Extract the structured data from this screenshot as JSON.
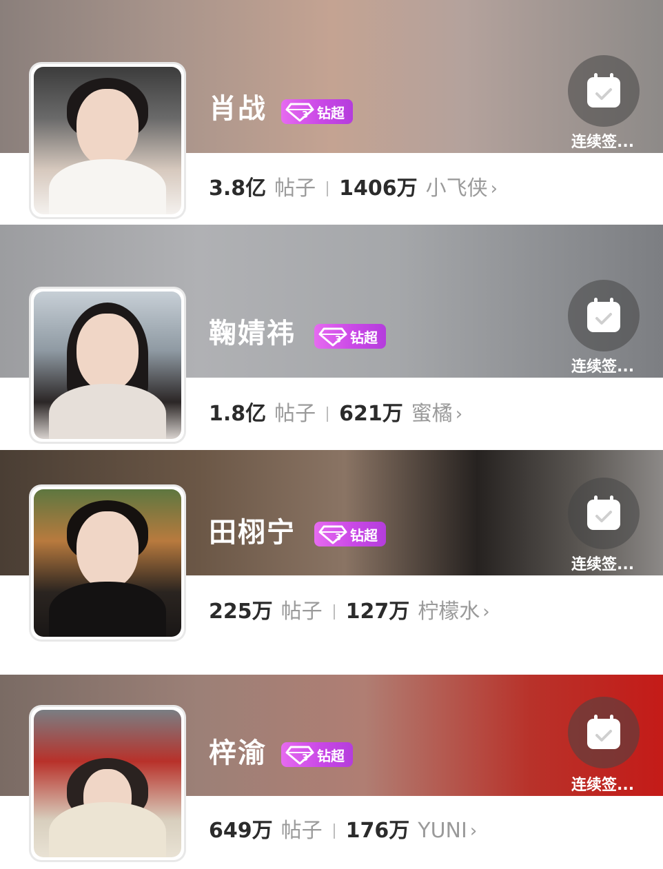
{
  "cards": [
    {
      "name": "肖战",
      "badge": "钻超",
      "checkin": "连续签...",
      "posts": "3.8亿",
      "posts_unit": "帖子",
      "fans": "1406万",
      "fan_name": "小飞侠",
      "hero_colors": [
        "#8a7f7b",
        "#c4a392",
        "#8d8a88"
      ]
    },
    {
      "name": "鞠婧祎",
      "badge": "钻超",
      "checkin": "连续签...",
      "posts": "1.8亿",
      "posts_unit": "帖子",
      "fans": "621万",
      "fan_name": "蜜橘",
      "hero_colors": [
        "#9c9da0",
        "#b0b1b4",
        "#7c7e82"
      ]
    },
    {
      "name": "田栩宁",
      "badge": "钻超",
      "checkin": "连续签...",
      "posts": "225万",
      "posts_unit": "帖子",
      "fans": "127万",
      "fan_name": "柠檬水",
      "hero_colors": [
        "#4a3e34",
        "#262220",
        "#8c8987"
      ]
    },
    {
      "name": "梓渝",
      "badge": "钻超",
      "checkin": "连续签...",
      "posts": "649万",
      "posts_unit": "帖子",
      "fans": "176万",
      "fan_name": "YUNI",
      "hero_colors": [
        "#7a6b64",
        "#b07e73",
        "#c41b18"
      ]
    }
  ],
  "icons": {
    "badge": "diamond-icon",
    "checkin": "calendar-check-icon",
    "more": "chevron-right-icon"
  },
  "colors": {
    "badge_start": "#e66bf0",
    "badge_end": "#b43ddc",
    "stat_number": "#2b2b2b",
    "stat_label": "#9a9a9a"
  }
}
